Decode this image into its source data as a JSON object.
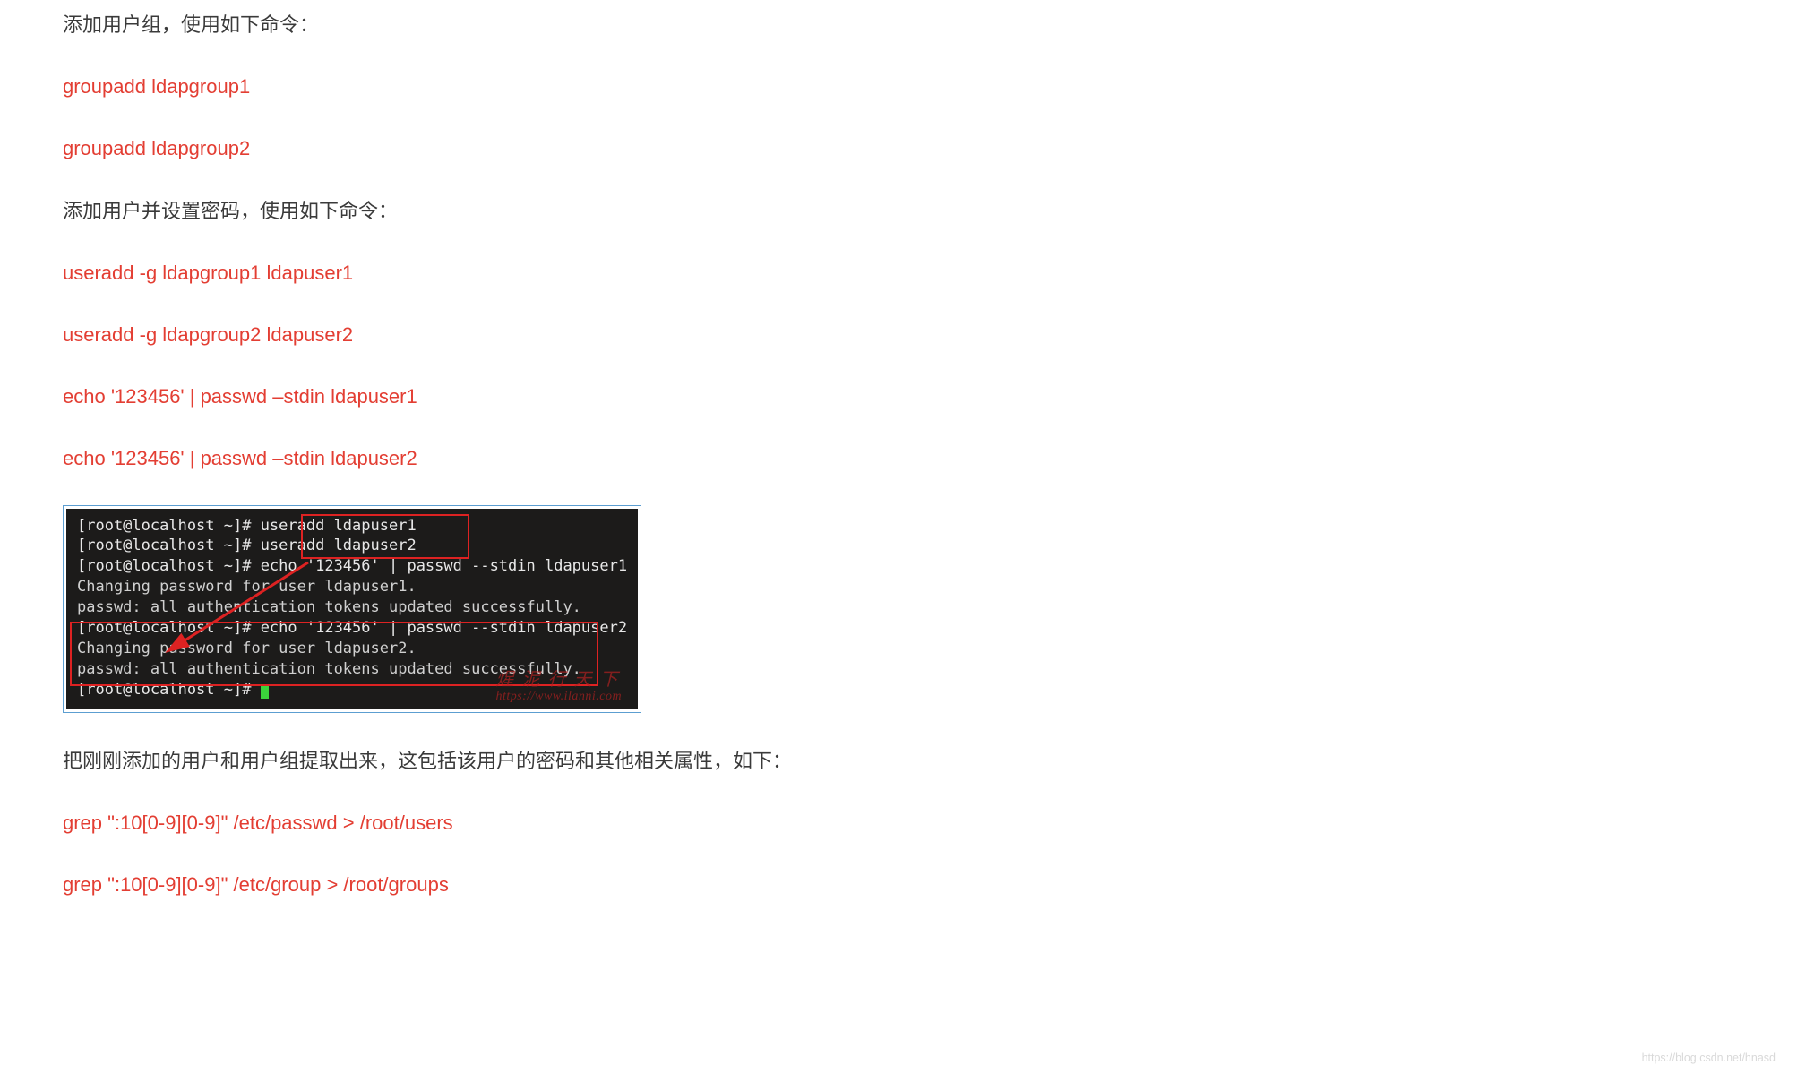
{
  "para1": "添加用户组，使用如下命令：",
  "cmd1": "groupadd ldapgroup1",
  "cmd2": "groupadd ldapgroup2",
  "para2": "添加用户并设置密码，使用如下命令：",
  "cmd3": "useradd -g ldapgroup1 ldapuser1",
  "cmd4": "useradd -g ldapgroup2 ldapuser2",
  "cmd5": "echo '123456' | passwd –stdin ldapuser1",
  "cmd6": "echo '123456' | passwd –stdin ldapuser2",
  "terminal": {
    "l1": "[root@localhost ~]# useradd ldapuser1",
    "l2": "[root@localhost ~]# useradd ldapuser2",
    "l3": "[root@localhost ~]# echo '123456' | passwd --stdin ldapuser1",
    "l4": "Changing password for user ldapuser1.",
    "l5": "passwd: all authentication tokens updated successfully.",
    "l6": "[root@localhost ~]# echo '123456' | passwd --stdin ldapuser2",
    "l7": "Changing password for user ldapuser2.",
    "l8": "passwd: all authentication tokens updated successfully.",
    "l9": "[root@localhost ~]# "
  },
  "watermark_main": "煋 泥 行 天 下",
  "watermark_url": "https://www.ilanni.com",
  "para3": "把刚刚添加的用户和用户组提取出来，这包括该用户的密码和其他相关属性，如下：",
  "cmd7": "grep \":10[0-9][0-9]\" /etc/passwd > /root/users",
  "cmd8": "grep \":10[0-9][0-9]\" /etc/group > /root/groups",
  "footer_mark": "https://blog.csdn.net/hnasd"
}
